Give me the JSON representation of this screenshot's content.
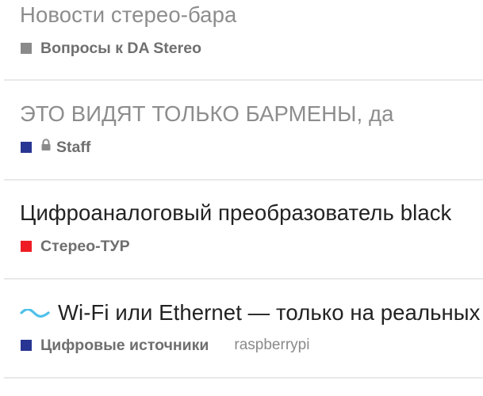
{
  "topics": [
    {
      "title": "Новости стерео-бара",
      "visited": true,
      "category": "Вопросы к DA Stereo",
      "category_color": "#8a8a8a"
    },
    {
      "title": "ЭТО ВИДЯТ ТОЛЬКО БАРМЕНЫ, да",
      "visited": true,
      "category": "Staff",
      "category_color": "#283593",
      "locked": true
    },
    {
      "title": "Цифроаналоговый преобразователь black",
      "visited": false,
      "category": "Стерео-ТУР",
      "category_color": "#ee1c24"
    },
    {
      "title": "Wi-Fi или Ethernet — только на реальных тестах",
      "visited": false,
      "prefix_icon": "wave-icon",
      "category": "Цифровые источники",
      "category_color": "#283593",
      "tag": "raspberrypi"
    }
  ],
  "colors": {
    "visited_title": "#8d8d8d",
    "title": "#222222",
    "divider": "#e9e9e9",
    "wave_icon": "#4fc1e9"
  }
}
